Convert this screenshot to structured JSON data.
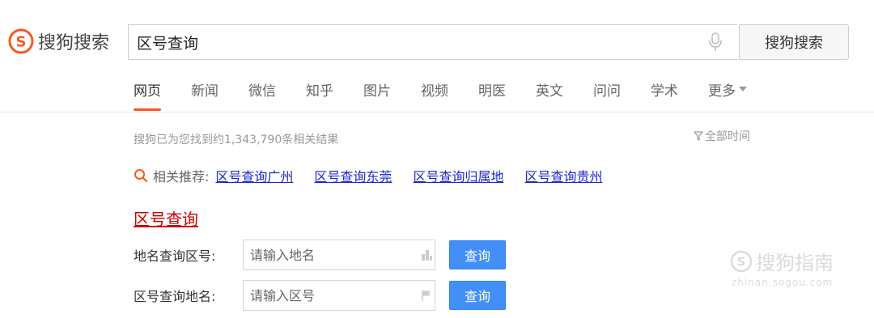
{
  "brand": {
    "name": "搜狗搜索",
    "accent_color": "#f65a1e",
    "logo_icon": "sogou-s-logo-icon"
  },
  "search": {
    "query": "区号查询",
    "mic_icon": "microphone-icon",
    "button_label": "搜狗搜索"
  },
  "tabs": [
    {
      "label": "网页",
      "active": true
    },
    {
      "label": "新闻"
    },
    {
      "label": "微信"
    },
    {
      "label": "知乎"
    },
    {
      "label": "图片"
    },
    {
      "label": "视频"
    },
    {
      "label": "明医"
    },
    {
      "label": "英文"
    },
    {
      "label": "问问"
    },
    {
      "label": "学术"
    },
    {
      "label": "更多"
    }
  ],
  "results": {
    "count_text": "搜狗已为您找到约1,343,790条相关结果",
    "time_filter": "全部时间",
    "related": {
      "label": "相关推荐:",
      "links": [
        "区号查询广州",
        "区号查询东莞",
        "区号查询归属地",
        "区号查询贵州"
      ]
    },
    "title": "区号查询",
    "title_color": "#c90000",
    "tool": {
      "row1_label": "地名查询区号:",
      "row1_placeholder": "请输入地名",
      "row2_label": "区号查询地名:",
      "row2_placeholder": "请输入区号",
      "button_label": "查询",
      "button_color": "#4290f7"
    }
  },
  "watermark": {
    "text": "搜狗指南",
    "url": "zhinan.sogou.com"
  }
}
